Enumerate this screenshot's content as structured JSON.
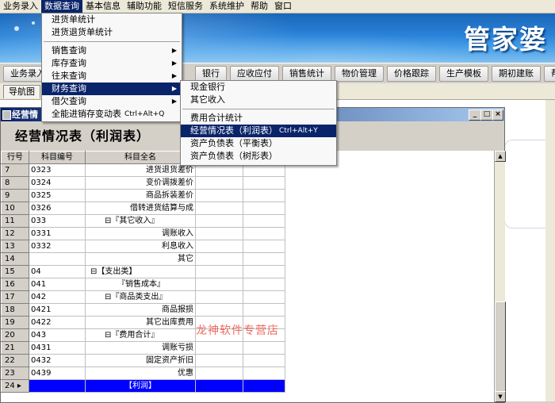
{
  "menubar": [
    "业务录入",
    "数据查询",
    "基本信息",
    "辅助功能",
    "短信服务",
    "系统维护",
    "帮助",
    "窗口"
  ],
  "banner": {
    "title": "管家婆"
  },
  "toolbar": [
    "业务录入",
    "银行",
    "应收应付",
    "销售统计",
    "物价管理",
    "价格跟踪",
    "生产模板",
    "期初建账",
    "帮"
  ],
  "tabs": {
    "nav": "导航图"
  },
  "child_window": {
    "title": "经营情",
    "buttons": {
      "min": "_",
      "max": "□",
      "close": "×"
    },
    "report_title": "经营情况表（利润表）"
  },
  "grid": {
    "columns": [
      "行号",
      "科目编号",
      "科目全名",
      "",
      ""
    ],
    "rows": [
      {
        "no": "7",
        "code": "0323",
        "name": "进货退货差价"
      },
      {
        "no": "8",
        "code": "0324",
        "name": "变价调拨差价"
      },
      {
        "no": "9",
        "code": "0325",
        "name": "商品拆装差价"
      },
      {
        "no": "10",
        "code": "0326",
        "name": "借转进货结算与成"
      },
      {
        "no": "11",
        "code": "033",
        "name": "⊟『其它收入』"
      },
      {
        "no": "12",
        "code": "0331",
        "name": "调账收入"
      },
      {
        "no": "13",
        "code": "0332",
        "name": "利息收入"
      },
      {
        "no": "14",
        "code": "",
        "name": "其它"
      },
      {
        "no": "15",
        "code": "04",
        "name": "⊟【支出类】"
      },
      {
        "no": "16",
        "code": "041",
        "name": "『销售成本』"
      },
      {
        "no": "17",
        "code": "042",
        "name": "⊟『商品类支出』"
      },
      {
        "no": "18",
        "code": "0421",
        "name": "商品报损"
      },
      {
        "no": "19",
        "code": "0422",
        "name": "其它出库费用"
      },
      {
        "no": "20",
        "code": "043",
        "name": "⊟『费用合计』"
      },
      {
        "no": "21",
        "code": "0431",
        "name": "调账亏损"
      },
      {
        "no": "22",
        "code": "0432",
        "name": "固定资产折旧"
      },
      {
        "no": "23",
        "code": "0439",
        "name": "优惠"
      },
      {
        "no": "24 ▸",
        "code": "",
        "name": "【利润】"
      }
    ]
  },
  "menu_data_query": [
    "进货单统计",
    "进货退货单统计",
    "销售查询",
    "库存查询",
    "往来查询",
    "财务查询",
    "借欠查询",
    "全能进销存变动表"
  ],
  "menu_data_query_shortcut": "Ctrl+Alt+Q",
  "menu_finance": [
    "现金银行",
    "其它收入",
    "费用合计统计",
    "经营情况表（利润表）",
    "资产负债表（平衡表）",
    "资产负债表（树形表）"
  ],
  "menu_finance_shortcut": "Ctrl+Alt+Y",
  "watermark": "龙神软件专营店",
  "colors": {
    "selection": "#0a246a",
    "selected_row": "#0000ff",
    "watermark": "#e8483c"
  }
}
